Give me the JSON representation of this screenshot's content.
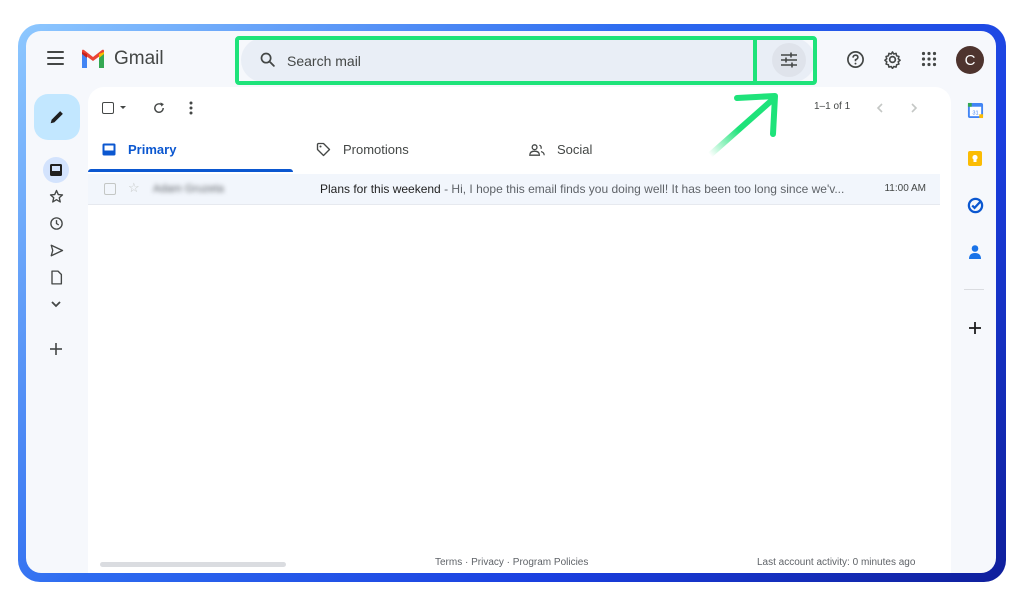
{
  "app": {
    "name": "Gmail"
  },
  "search": {
    "placeholder": "Search mail"
  },
  "account": {
    "initial": "C"
  },
  "pager": {
    "range": "1–1 of 1"
  },
  "tabs": [
    {
      "label": "Primary",
      "active": true
    },
    {
      "label": "Promotions",
      "active": false
    },
    {
      "label": "Social",
      "active": false
    }
  ],
  "emails": [
    {
      "sender": "Adam Gruzeta",
      "subject": "Plans for this weekend",
      "snippet": " - Hi, I hope this email finds you doing well! It has been too long since we'v...",
      "time": "11:00 AM"
    }
  ],
  "footer": {
    "links": "Terms · Privacy · Program Policies",
    "activity": "Last account activity: 0 minutes ago"
  },
  "colors": {
    "accent": "#0b57d0",
    "highlight": "#1ee37a",
    "compose": "#c2e7ff"
  },
  "icons": {
    "header": [
      "menu-icon",
      "search-icon",
      "tune-icon",
      "help-icon",
      "gear-icon",
      "apps-icon"
    ],
    "rail": [
      "pencil-icon",
      "inbox-icon",
      "star-icon",
      "clock-icon",
      "send-icon",
      "file-icon",
      "chevron-down-icon",
      "plus-icon"
    ],
    "right_rail": [
      "calendar-icon",
      "keep-icon",
      "tasks-icon",
      "contacts-icon",
      "plus-icon"
    ]
  }
}
